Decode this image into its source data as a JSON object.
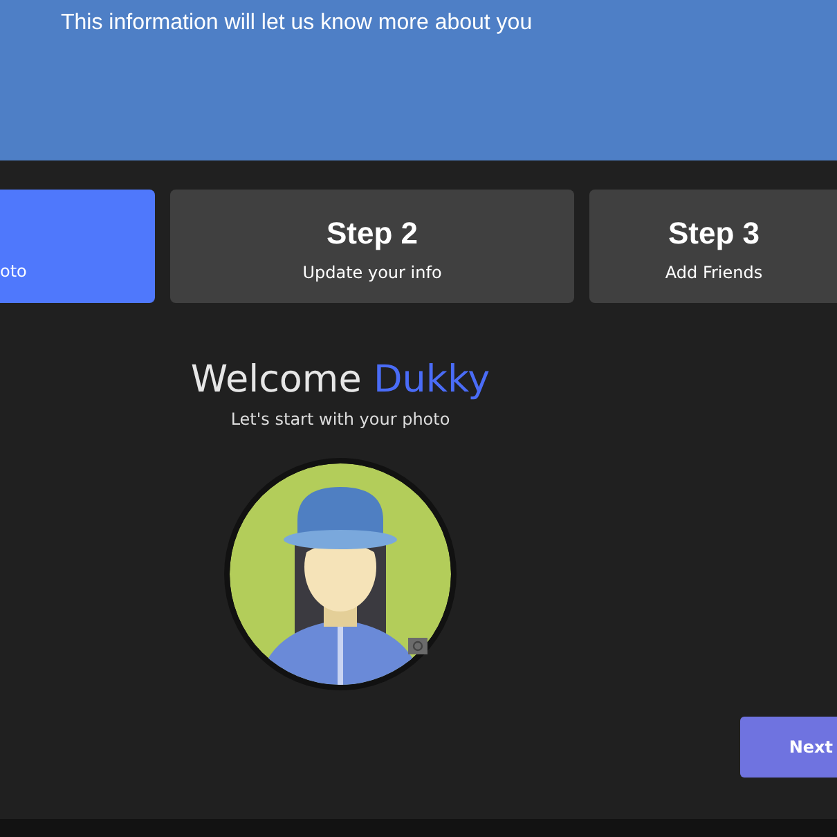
{
  "header": {
    "subtitle": "This information will let us know more about you"
  },
  "steps": [
    {
      "subtitle": "oto",
      "selected": true
    },
    {
      "title": "Step 2",
      "subtitle": "Update your info",
      "selected": false
    },
    {
      "title": "Step 3",
      "subtitle": "Add Friends",
      "selected": false
    }
  ],
  "welcome": {
    "greeting": "Welcome",
    "name": "Dukky",
    "prompt": "Let's start with your photo"
  },
  "next_button": "Next"
}
